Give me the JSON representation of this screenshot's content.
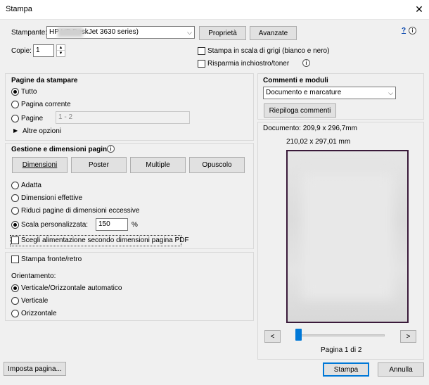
{
  "window": {
    "title": "Stampa"
  },
  "printer": {
    "label": "Stampante:",
    "selected": "HP        HP DeskJet 3630 series)",
    "properties_button": "Proprietà",
    "advanced_button": "Avanzate",
    "help_link": "?"
  },
  "copies": {
    "label": "Copie:",
    "value": "1"
  },
  "options": {
    "grayscale": "Stampa in scala di grigi (bianco e nero)",
    "save_ink": "Risparmia inchiostro/toner"
  },
  "pages": {
    "title": "Pagine da stampare",
    "all": "Tutto",
    "current": "Pagina corrente",
    "range": "Pagine",
    "range_placeholder": "1 - 2",
    "more": "Altre opzioni"
  },
  "sizing": {
    "title": "Gestione e dimensioni pagina",
    "tabs": [
      "Dimensioni",
      "Poster",
      "Multiple",
      "Opuscolo"
    ],
    "fit": "Adatta",
    "actual": "Dimensioni effettive",
    "shrink": "Riduci pagine di dimensioni eccessive",
    "custom": "Scala personalizzata:",
    "custom_value": "150",
    "custom_unit": "%",
    "paper_source": "Scegli alimentazione secondo dimensioni pagina PDF"
  },
  "duplex": {
    "label": "Stampa fronte/retro"
  },
  "orientation": {
    "title": "Orientamento:",
    "auto": "Verticale/Orizzontale automatico",
    "portrait": "Verticale",
    "landscape": "Orizzontale"
  },
  "comments": {
    "title": "Commenti e moduli",
    "selected": "Documento e marcature",
    "summarize_button": "Riepiloga commenti"
  },
  "preview": {
    "document_size": "Documento: 209,9 x 296,7mm",
    "page_size": "210,02 x 297,01 mm",
    "page_indicator": "Pagina 1 di 2",
    "prev": "<",
    "next": ">"
  },
  "footer": {
    "page_setup": "Imposta pagina...",
    "print": "Stampa",
    "cancel": "Annulla"
  }
}
